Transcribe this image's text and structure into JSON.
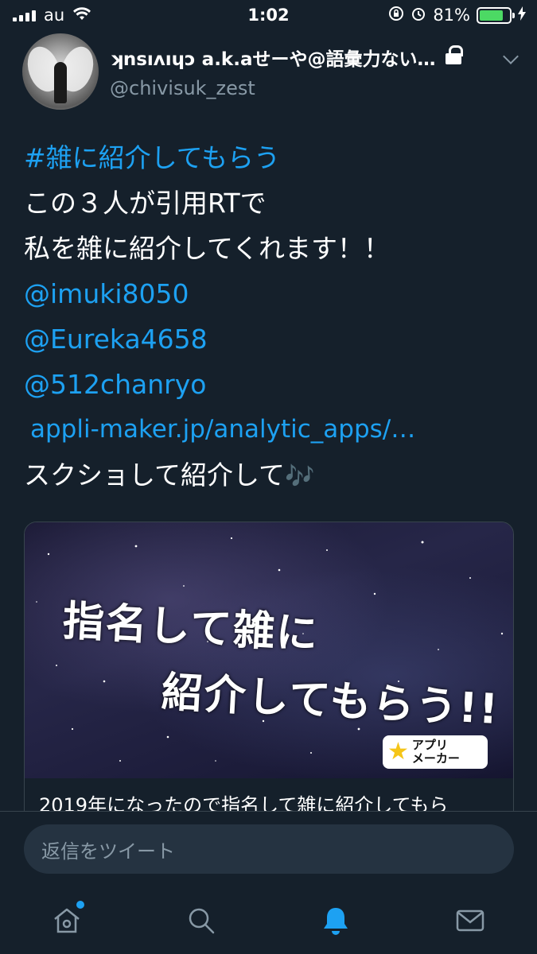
{
  "status_bar": {
    "carrier": "au",
    "time": "1:02",
    "battery_percent": "81%",
    "battery_level": 0.81
  },
  "tweet": {
    "display_name": "ʞnsıʌıɥɔ a.k.aせーや@語彙力ない…",
    "handle": "@chivisuk_zest",
    "hashtag": "#雑に紹介してもらう",
    "line1": "この３人が引用RTで",
    "line2": "私を雑に紹介してくれます！！",
    "mentions": [
      "@imuki8050",
      "@Eureka4658",
      "@512chanryo"
    ],
    "url": "appli-maker.jp/analytic_apps/…",
    "line_last": "スクショして紹介して",
    "emoji": "🎶"
  },
  "card": {
    "headline_line1": "指名して雑に",
    "headline_line2": "紹介してもらう!!",
    "brand_line1": "アプリ",
    "brand_line2": "メーカー",
    "title": "2019年になったので指名して雑に紹介してもら"
  },
  "reply": {
    "placeholder": "返信をツイート"
  },
  "tabs": {
    "home_icon": "home-icon",
    "search_icon": "search-icon",
    "notifications_icon": "bell-icon",
    "messages_icon": "mail-icon",
    "accent": "#1da1f2"
  },
  "colors": {
    "background": "#15202b",
    "link": "#1da1f2",
    "secondary_text": "#8899a6"
  }
}
